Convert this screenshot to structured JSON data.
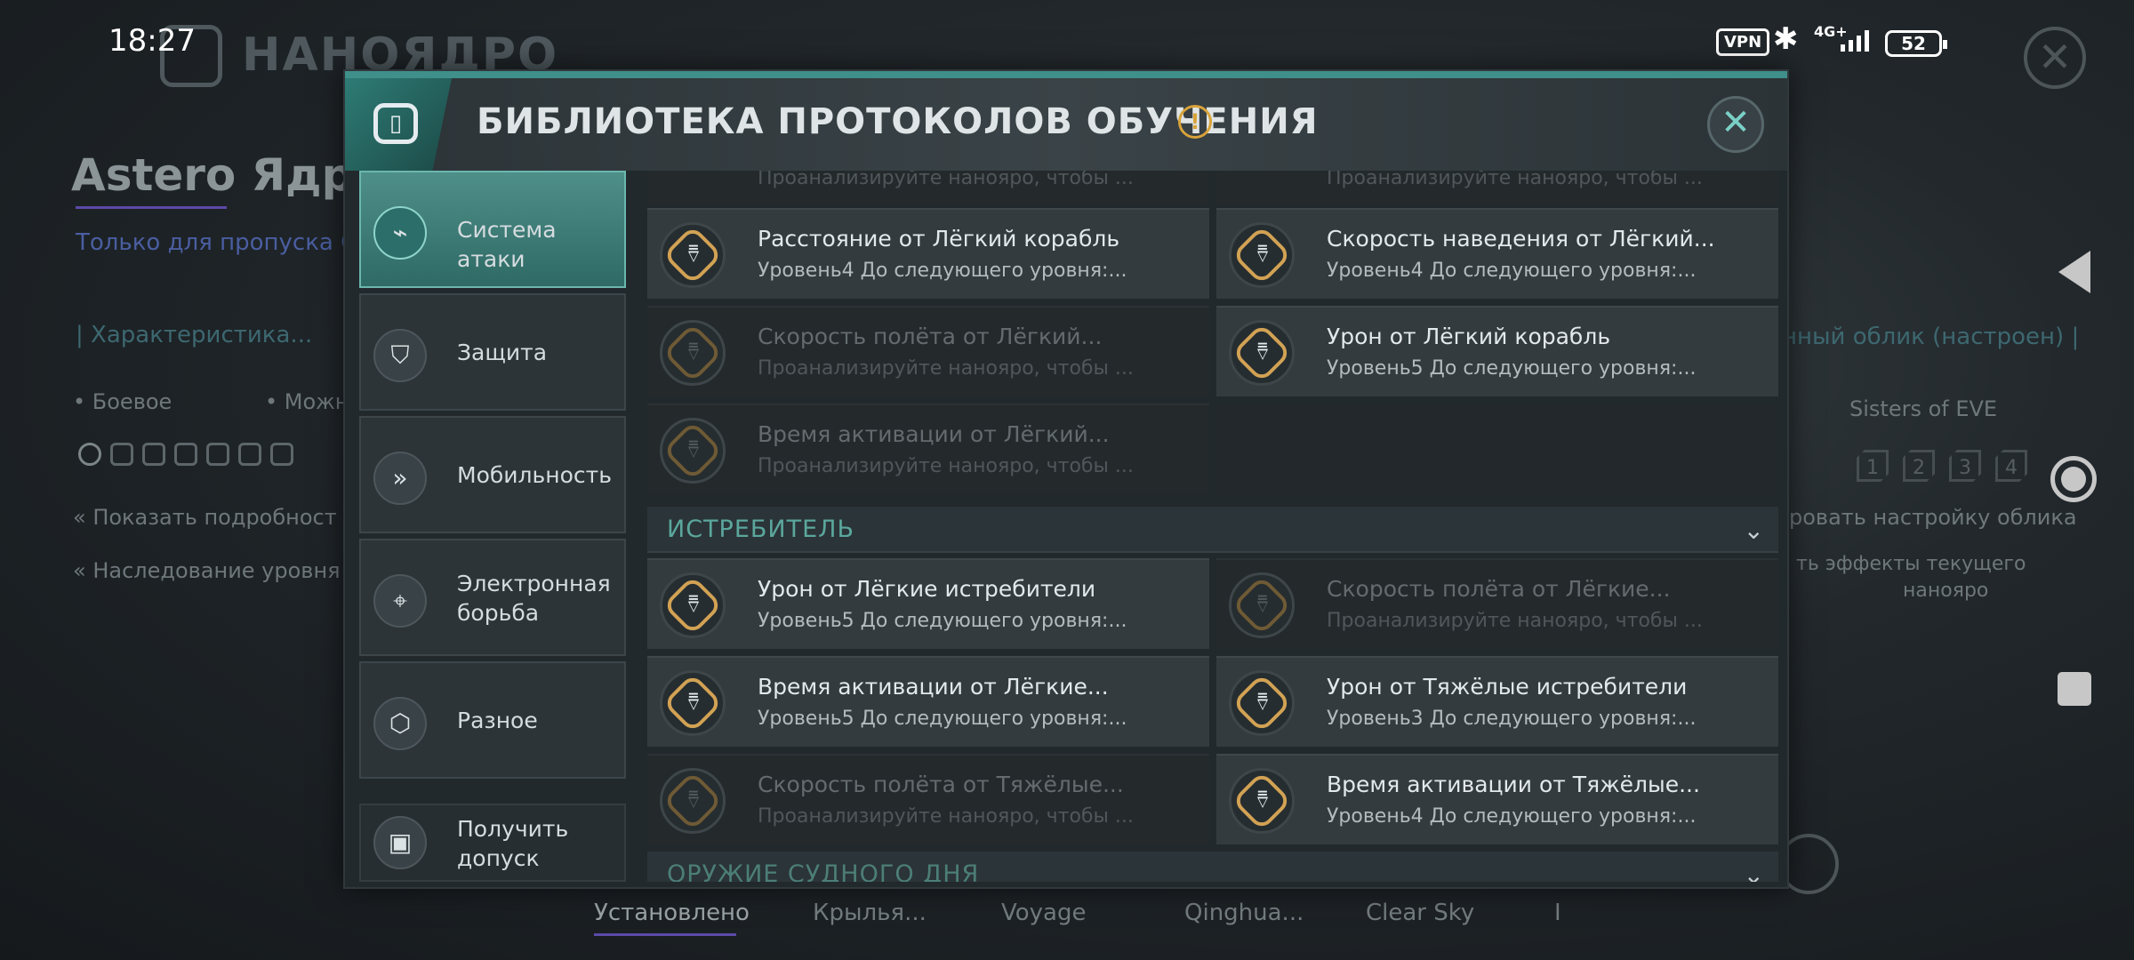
{
  "status_bar": {
    "time": "18:27",
    "vpn": "VPN",
    "network": "4G+",
    "battery": "52"
  },
  "background": {
    "title": "НАНОЯДРО",
    "ship_name": "Astero Ядро",
    "pass_note": "Только для пропуска СО",
    "characteristic": "| Характеристика...",
    "combat": "• Боевое",
    "can": "• Можн",
    "show_details": "Показать подробност",
    "inherit_level": "Наследование уровня",
    "skin_tuned": "нный облик (настроен) |",
    "sisters": "Sisters of EVE",
    "skin_setting": "ровать настройку облика",
    "effects_line1": "ть эффекты текущего",
    "effects_line2": "нанояро",
    "levels": [
      "1",
      "2",
      "3",
      "4"
    ],
    "bottom_tabs": [
      "Установлено",
      "Крылья...",
      "Voyage",
      "Qinghua...",
      "Clear Sky",
      "I"
    ]
  },
  "dialog": {
    "title": "БИБЛИОТЕКА ПРОТОКОЛОВ ОБУЧЕНИЯ",
    "info_icon": "!",
    "close_icon": "✕"
  },
  "sidebar": {
    "items": [
      {
        "label": "Система атаки",
        "icon": "attack-icon",
        "active": true
      },
      {
        "label": "Защита",
        "icon": "shield-icon",
        "active": false
      },
      {
        "label": "Мобильность",
        "icon": "mobility-icon",
        "active": false
      },
      {
        "label": "Электронная борьба",
        "icon": "electronic-warfare-icon",
        "active": false
      },
      {
        "label": "Разное",
        "icon": "cube-icon",
        "active": false
      }
    ],
    "get_access": "Получить допуск"
  },
  "content": {
    "top_partial": [
      {
        "sub": "Проанализируйте нанояро, чтобы ..."
      },
      {
        "sub": "Проанализируйте нанояро, чтобы ..."
      }
    ],
    "light_ship_cards": [
      {
        "title": "Расстояние от Лёгкий корабль",
        "sub": "Уровень4  До следующего уровня:...",
        "locked": false
      },
      {
        "title": "Скорость наведения от Лёгкий...",
        "sub": "Уровень4  До следующего уровня:...",
        "locked": false
      },
      {
        "title": "Скорость полёта от Лёгкий...",
        "sub": "Проанализируйте нанояро, чтобы ...",
        "locked": true
      },
      {
        "title": "Урон от Лёгкий корабль",
        "sub": "Уровень5  До следующего уровня:...",
        "locked": false
      },
      {
        "title": "Время активации от Лёгкий...",
        "sub": "Проанализируйте нанояро, чтобы ...",
        "locked": true
      }
    ],
    "section_fighter": "ИСТРЕБИТЕЛЬ",
    "fighter_cards": [
      {
        "title": "Урон от Лёгкие истребители",
        "sub": "Уровень5  До следующего уровня:...",
        "locked": false
      },
      {
        "title": "Скорость полёта от Лёгкие...",
        "sub": "Проанализируйте нанояро, чтобы ...",
        "locked": true
      },
      {
        "title": "Время активации от Лёгкие...",
        "sub": "Уровень5  До следующего уровня:...",
        "locked": false
      },
      {
        "title": "Урон от Тяжёлые истребители",
        "sub": "Уровень3  До следующего уровня:...",
        "locked": false
      },
      {
        "title": "Скорость полёта от Тяжёлые...",
        "sub": "Проанализируйте нанояро, чтобы ...",
        "locked": true
      },
      {
        "title": "Время активации от Тяжёлые...",
        "sub": "Уровень4  До следующего уровня:...",
        "locked": false
      }
    ],
    "section_next": "ОРУЖИЕ СУДНОГО ДНЯ"
  }
}
